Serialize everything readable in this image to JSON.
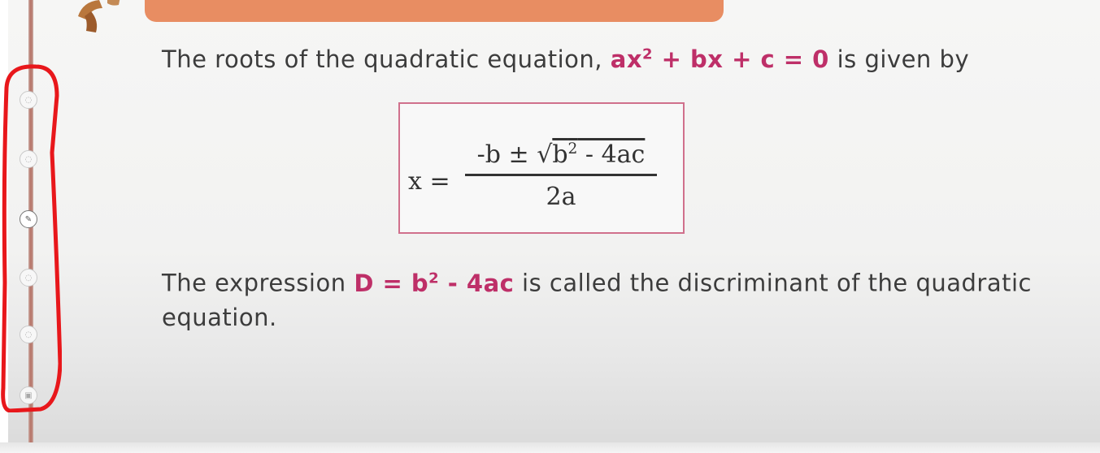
{
  "content": {
    "line1": {
      "lead": "The roots of the quadratic equation, ",
      "eq_a": "ax",
      "eq_exp": "2",
      "eq_rest": " + bx + c = 0",
      "tail": " is given by"
    },
    "formula": {
      "lhs": "x =",
      "num_lead": "-b ± ",
      "radical_sign": "√",
      "rad_b": "b",
      "rad_exp": "2",
      "rad_rest": " - 4ac",
      "denominator": "2a"
    },
    "line2": {
      "lead": "The expression ",
      "d_lead": "D = b",
      "d_exp": "2",
      "d_rest": " - 4ac",
      "tail": " is called the discriminant of the quadratic equation."
    }
  },
  "colors": {
    "highlight": "#be2f68",
    "formula_border": "#d0708c",
    "banner": "#e88d62",
    "annotation": "#e8171b",
    "body_text": "#3c3c3c"
  },
  "toolbar": {
    "icons": [
      "circle-tool-icon",
      "circle-tool-icon",
      "pen-tool-icon",
      "circle-tool-icon",
      "circle-tool-icon",
      "screen-tool-icon"
    ]
  }
}
